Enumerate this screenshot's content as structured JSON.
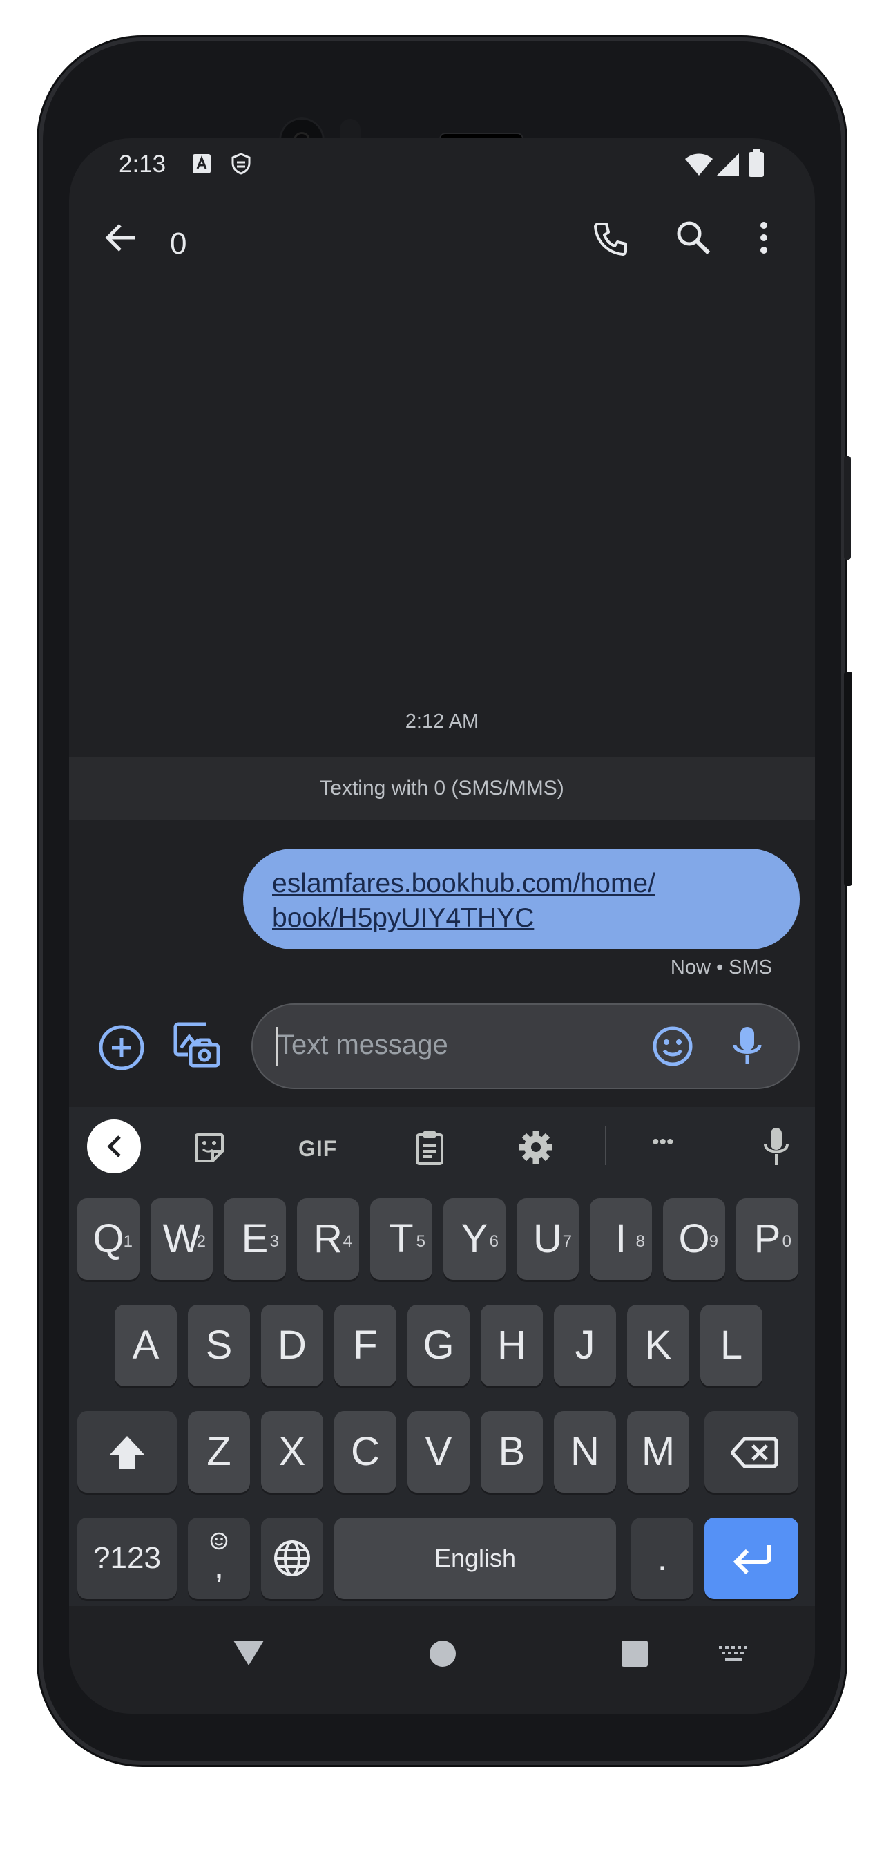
{
  "status_bar": {
    "time": "2:13"
  },
  "app_bar": {
    "title": "0"
  },
  "conversation": {
    "timestamp": "2:12 AM",
    "banner": "Texting with 0 (SMS/MMS)",
    "messages": [
      {
        "text_line1": "eslamfares.bookhub.com/home/",
        "text_line2": "book/H5pyUIY4THYC",
        "meta": "Now • SMS"
      }
    ]
  },
  "composer": {
    "placeholder": "Text message"
  },
  "keyboard": {
    "toolbar": {
      "gif_label": "GIF",
      "more_label": "•••"
    },
    "row1": [
      {
        "label": "Q",
        "hint": "1"
      },
      {
        "label": "W",
        "hint": "2"
      },
      {
        "label": "E",
        "hint": "3"
      },
      {
        "label": "R",
        "hint": "4"
      },
      {
        "label": "T",
        "hint": "5"
      },
      {
        "label": "Y",
        "hint": "6"
      },
      {
        "label": "U",
        "hint": "7"
      },
      {
        "label": "I",
        "hint": "8"
      },
      {
        "label": "O",
        "hint": "9"
      },
      {
        "label": "P",
        "hint": "0"
      }
    ],
    "row2": [
      "A",
      "S",
      "D",
      "F",
      "G",
      "H",
      "J",
      "K",
      "L"
    ],
    "row3": [
      "Z",
      "X",
      "C",
      "V",
      "B",
      "N",
      "M"
    ],
    "symbols_label": "?123",
    "comma_label": ",",
    "space_label": "English",
    "period_label": "."
  },
  "colors": {
    "accent": "#5591f6",
    "bubble": "#82a8e8",
    "background": "#202124"
  }
}
